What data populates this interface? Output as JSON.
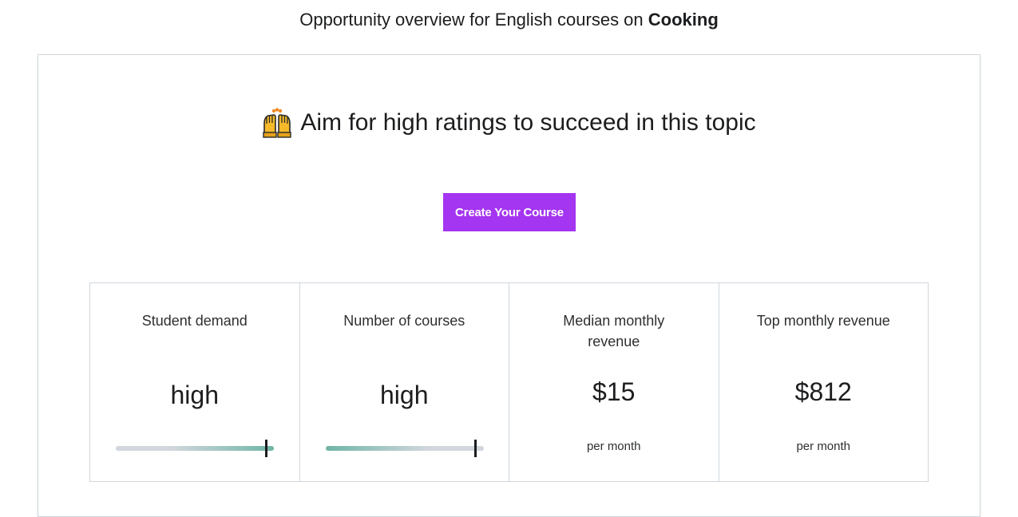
{
  "header": {
    "prefix": "Opportunity overview for English courses on ",
    "topic": "Cooking"
  },
  "headline": {
    "icon": "raising-hands-icon",
    "text": "Aim for high ratings to succeed in this topic"
  },
  "cta": {
    "label": "Create Your Course",
    "color": "#a435f0"
  },
  "metrics": [
    {
      "title": "Student demand",
      "value": "high",
      "level": 0.95
    },
    {
      "title": "Number of courses",
      "value": "high",
      "level": 0.95
    },
    {
      "title": "Median monthly revenue",
      "value": "$15",
      "sub": "per month"
    },
    {
      "title": "Top monthly revenue",
      "value": "$812",
      "sub": "per month"
    }
  ],
  "colors": {
    "accent": "#a435f0",
    "bar_high": "#6fb5a6",
    "bar_low": "#d1d7dc"
  }
}
